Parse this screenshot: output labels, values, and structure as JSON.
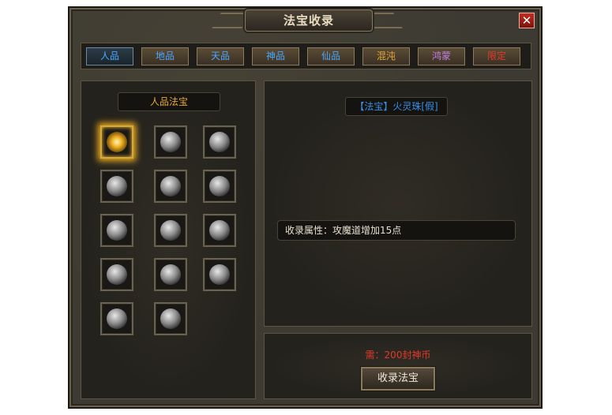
{
  "window": {
    "title": "法宝收录",
    "close_glyph": "✕"
  },
  "tabs": [
    {
      "label": "人品",
      "color": "#4aa8ff",
      "active": true
    },
    {
      "label": "地品",
      "color": "#4aa8ff",
      "active": false
    },
    {
      "label": "天品",
      "color": "#4aa8ff",
      "active": false
    },
    {
      "label": "神品",
      "color": "#4aa8ff",
      "active": false
    },
    {
      "label": "仙品",
      "color": "#4aa8ff",
      "active": false
    },
    {
      "label": "混沌",
      "color": "#e8a838",
      "active": false
    },
    {
      "label": "鸿蒙",
      "color": "#c080e0",
      "active": false
    },
    {
      "label": "限定",
      "color": "#e23a2a",
      "active": false
    }
  ],
  "left_panel": {
    "category_label": "人品法宝",
    "items": [
      {
        "icon": "orb-glow-icon",
        "selected": true
      },
      {
        "icon": "bronze-mirror-icon",
        "selected": false
      },
      {
        "icon": "eye-ring-icon",
        "selected": false
      },
      {
        "icon": "tassel-bell-icon",
        "selected": false
      },
      {
        "icon": "claw-bracelet-icon",
        "selected": false
      },
      {
        "icon": "fan-shell-icon",
        "selected": false
      },
      {
        "icon": "skull-cauldron-icon",
        "selected": false
      },
      {
        "icon": "dagger-ornament-icon",
        "selected": false
      },
      {
        "icon": "tripod-icon",
        "selected": false
      },
      {
        "icon": "serpent-ring-icon",
        "selected": false
      },
      {
        "icon": "beaded-eye-icon",
        "selected": false
      },
      {
        "icon": "spear-icon",
        "selected": false
      },
      {
        "icon": "pearl-icon",
        "selected": false
      },
      {
        "icon": "dragon-coil-icon",
        "selected": false
      }
    ]
  },
  "detail": {
    "item_name": "【法宝】火灵珠[假]",
    "item_name_color": "#3a8ee8",
    "attribute_text": "收录属性：攻魔道增加15点"
  },
  "footer": {
    "cost_text": "需：200封神币",
    "collect_button": "收录法宝"
  }
}
